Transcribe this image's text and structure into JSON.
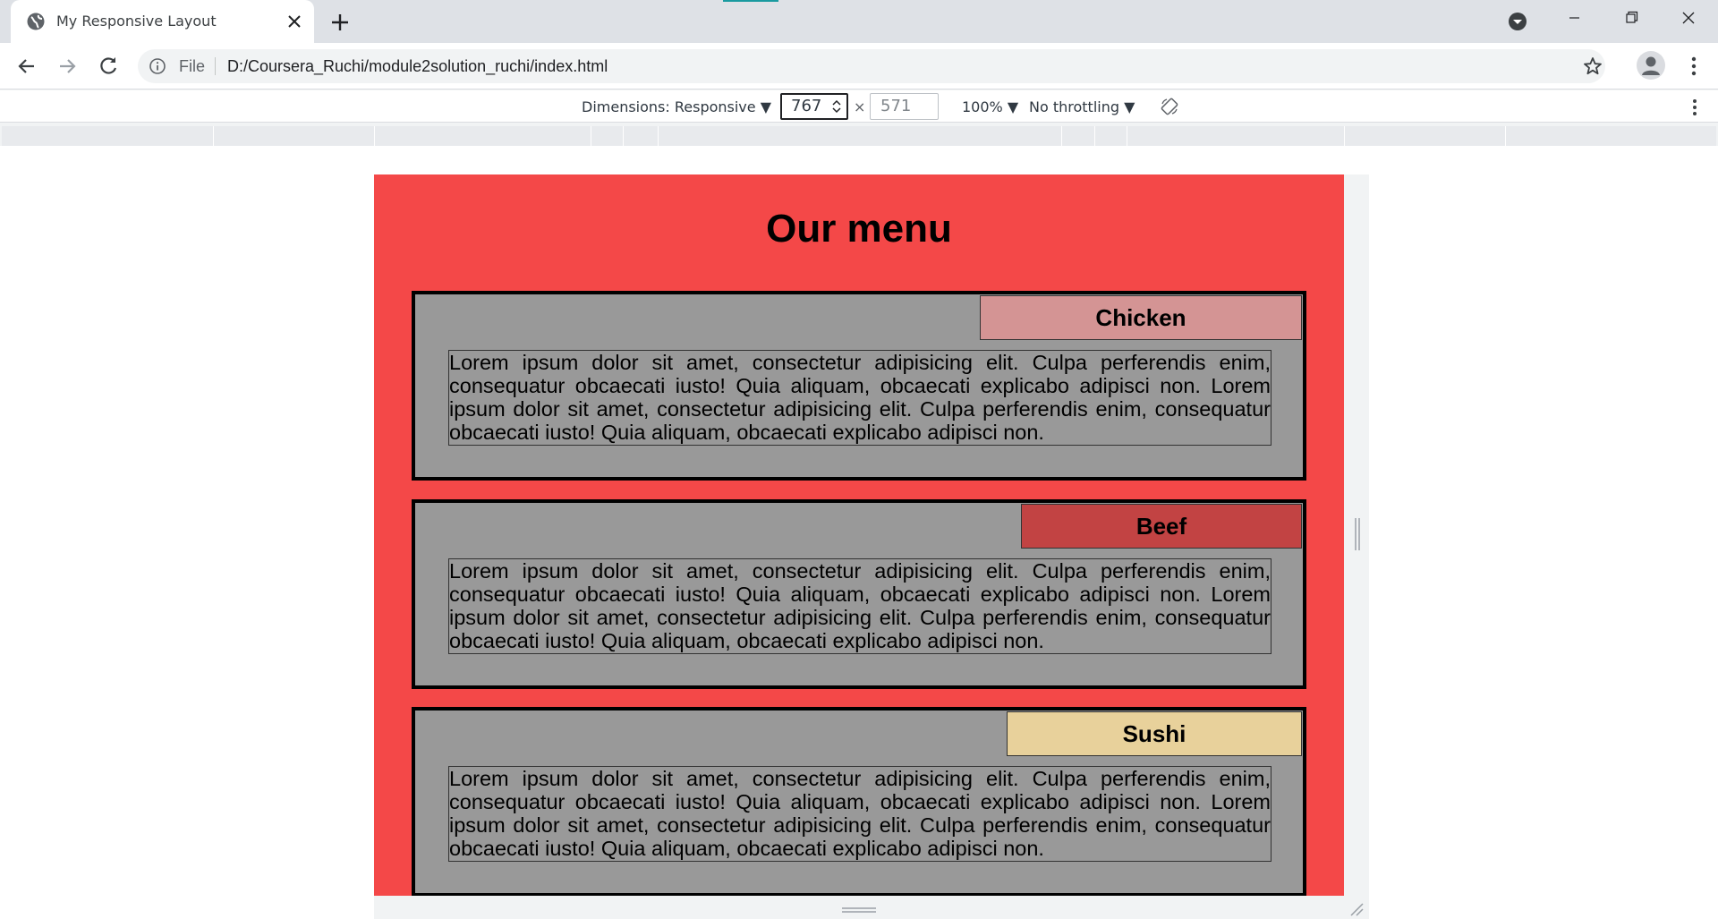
{
  "browser": {
    "tab_title": "My Responsive Layout",
    "omnibox_scheme": "File",
    "url": "D:/Coursera_Ruchi/module2solution_ruchi/index.html"
  },
  "devtools": {
    "dimensions_label": "Dimensions: Responsive ▼",
    "width_value": "767",
    "times_sign": "×",
    "height_value": "571",
    "zoom_label": "100% ▼",
    "throttle_label": "No throttling ▼"
  },
  "page": {
    "heading": "Our menu",
    "sections": [
      {
        "title": "Chicken",
        "title_color": "#d49494",
        "text": "Lorem ipsum dolor sit amet, consectetur adipisicing elit. Culpa perferendis enim, consequatur obcaecati iusto! Quia aliquam, obcaecati explicabo adipisci non. Lorem ipsum dolor sit amet, consectetur adipisicing elit. Culpa perferendis enim, consequatur obcaecati iusto! Quia aliquam, obcaecati explicabo adipisci non."
      },
      {
        "title": "Beef",
        "title_color": "#c24343",
        "text": "Lorem ipsum dolor sit amet, consectetur adipisicing elit. Culpa perferendis enim, consequatur obcaecati iusto! Quia aliquam, obcaecati explicabo adipisci non. Lorem ipsum dolor sit amet, consectetur adipisicing elit. Culpa perferendis enim, consequatur obcaecati iusto! Quia aliquam, obcaecati explicabo adipisci non."
      },
      {
        "title": "Sushi",
        "title_color": "#e8d19b",
        "text": "Lorem ipsum dolor sit amet, consectetur adipisicing elit. Culpa perferendis enim, consequatur obcaecati iusto! Quia aliquam, obcaecati explicabo adipisci non. Lorem ipsum dolor sit amet, consectetur adipisicing elit. Culpa perferendis enim, consequatur obcaecati iusto! Quia aliquam, obcaecati explicabo adipisci non."
      }
    ]
  },
  "colors": {
    "page_background": "#f44848",
    "section_background": "#999999"
  },
  "icons": [
    "globe-icon",
    "close-icon",
    "plus-icon",
    "profile-dropdown-icon",
    "minimize-icon",
    "restore-icon",
    "close-window-icon",
    "back-icon",
    "forward-icon",
    "reload-icon",
    "info-icon",
    "star-icon",
    "account-icon",
    "kebab-menu-icon",
    "rotate-icon"
  ]
}
